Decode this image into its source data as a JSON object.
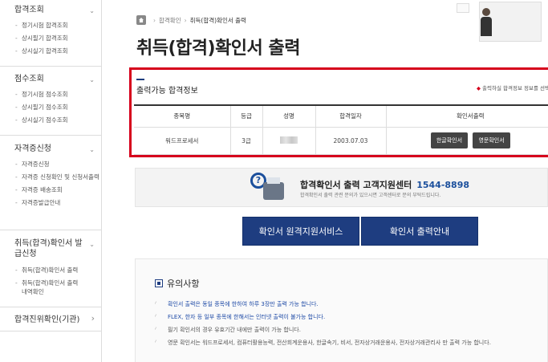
{
  "sidebar": {
    "sections": [
      {
        "title": "합격조회",
        "chevron": "⌄",
        "items": [
          "정기시험 합격조회",
          "상시필기 합격조회",
          "상시실기 합격조회"
        ]
      },
      {
        "title": "점수조회",
        "chevron": "⌄",
        "items": [
          "정기시험 점수조회",
          "상시필기 점수조회",
          "상시실기 점수조회"
        ]
      },
      {
        "title": "자격증신청",
        "chevron": "⌄",
        "items": [
          "자격증신청",
          "자격증 신청확인 및 신청서출력",
          "자격증 배송조회",
          "자격증발급안내"
        ]
      },
      {
        "title": "취득(합격)확인서 발급신청",
        "chevron": "⌄",
        "items": [
          "취득(합격)확인서 출력",
          "취득(합격)확인서 출력내역확인"
        ]
      },
      {
        "title": "합격진위확인(기관)",
        "chevron": "›",
        "items": []
      }
    ]
  },
  "breadcrumb": {
    "parent": "합격확인",
    "current": "취득(합격)확인서 출력"
  },
  "page_title": "취득(합격)확인서 출력",
  "pass_info": {
    "title": "출력가능 합격정보",
    "note": "출력하실 합격정보 정보를 선택",
    "columns": [
      "종목명",
      "등급",
      "성명",
      "합격일자",
      "확인서출력"
    ],
    "rows": [
      {
        "subject": "워드프로세서",
        "grade": "3급",
        "name": "",
        "date": "2003.07.03",
        "btn_kr": "한글확인서",
        "btn_en": "영문확인서"
      }
    ]
  },
  "support": {
    "title": "합격확인서 출력 고객지원센터",
    "phone": "1544-8898",
    "sub": "합격확인서 출력 관련 문의가 있으시면 고객센터로 문의 부탁드립니다."
  },
  "buttons": {
    "remote": "확인서 원격지원서비스",
    "guide": "확인서 출력안내"
  },
  "notice": {
    "title": "유의사항",
    "items": [
      "확인서 출력은 동일 종목에 한하여 하루 3장만 출력 가능 합니다.",
      "FLEX, 한자 등 일부 종목에 한해서는 인터넷 출력이 불가능 합니다.",
      "필기 확인서의 경우 유효기간 내에만 출력이 가능 합니다.",
      "영문 확인서는 워드프로세서, 컴퓨터활용능력, 전산회계운용사, 한글속기, 비서, 전자상거래운용사, 전자상거래관리사 만 출력 가능 합니다."
    ]
  }
}
